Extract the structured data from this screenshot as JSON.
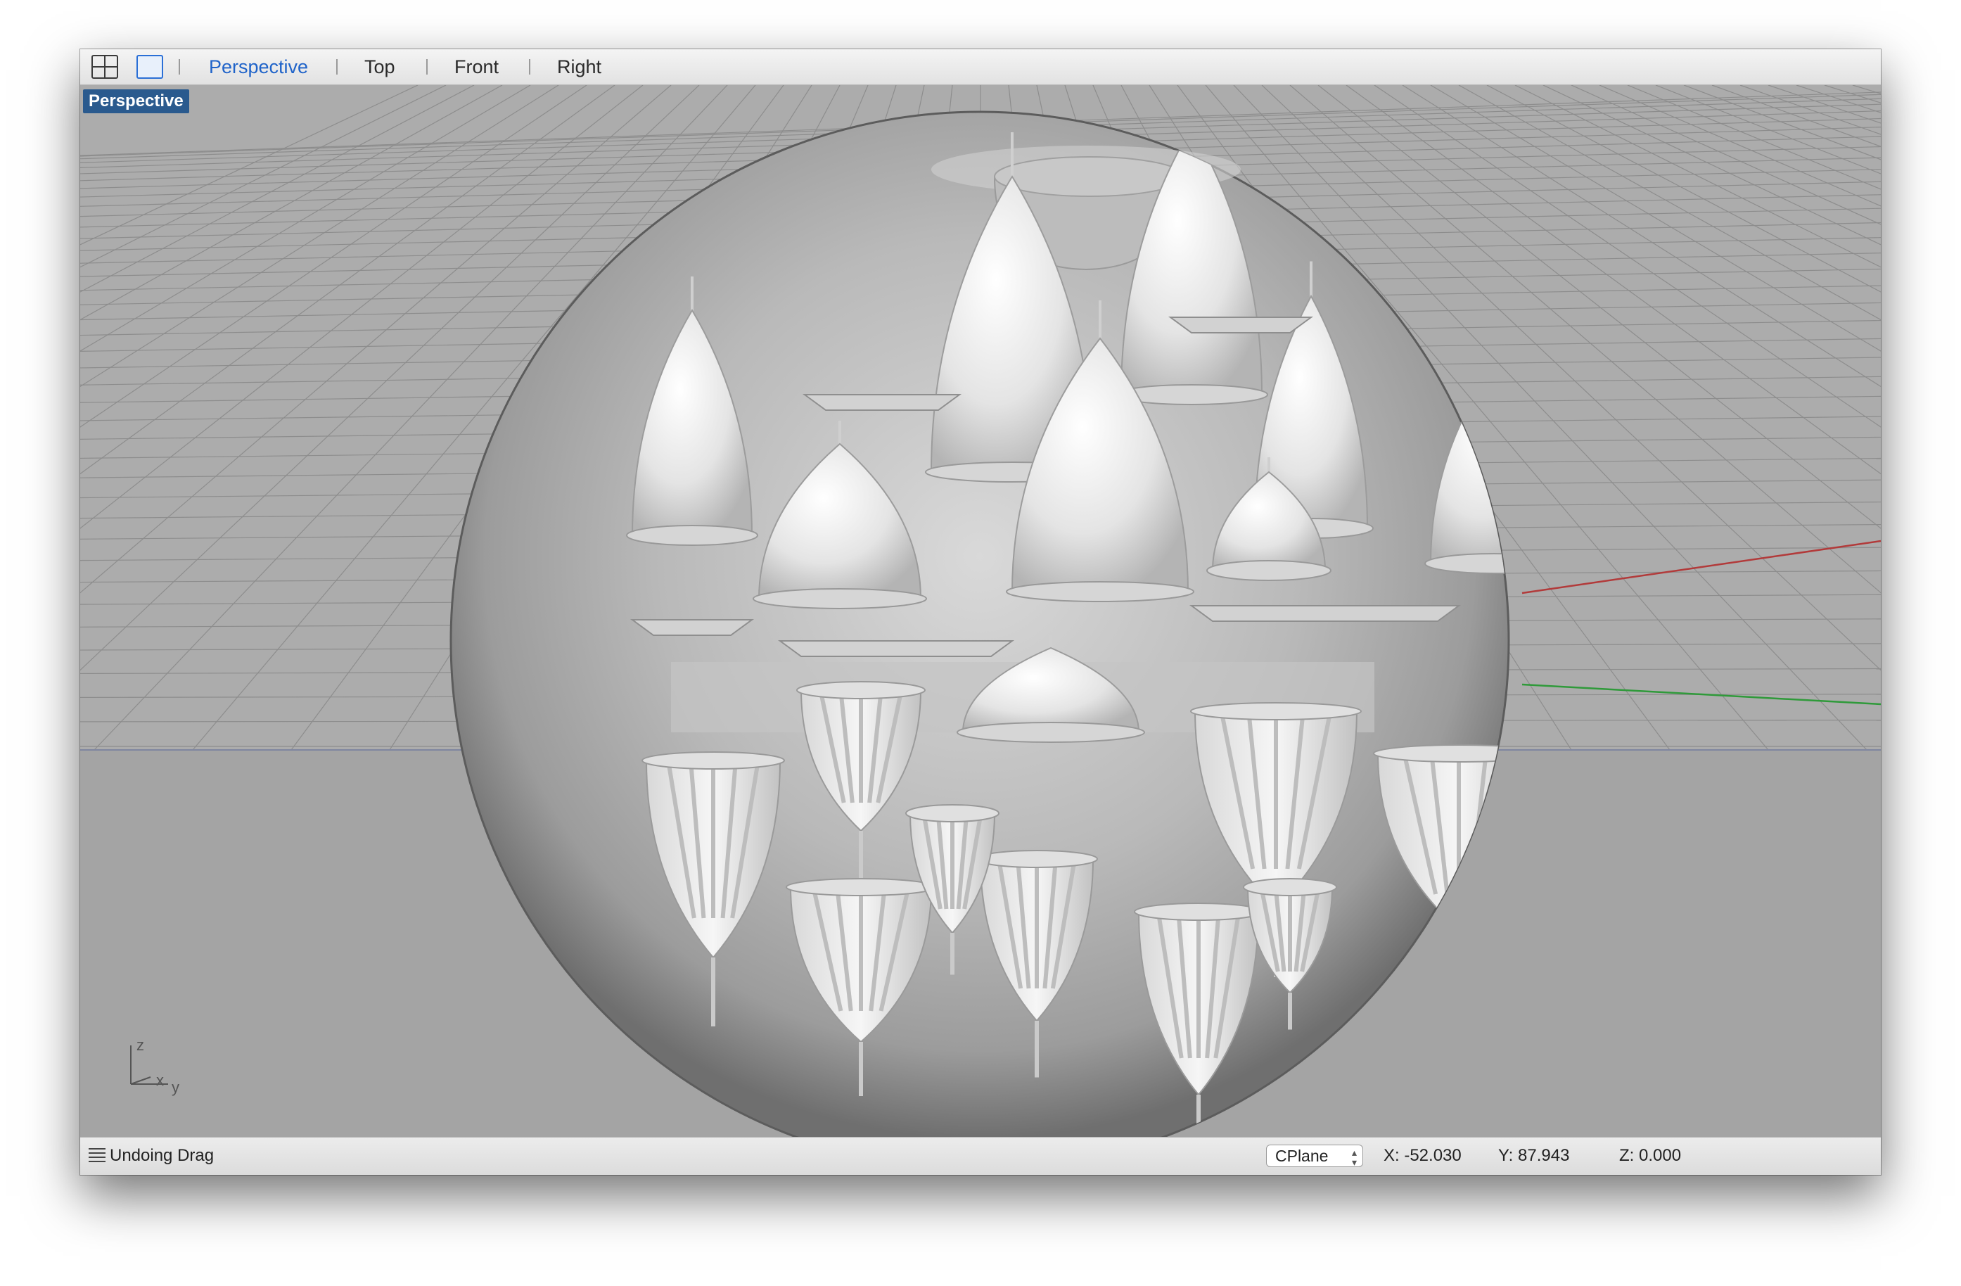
{
  "toolbar": {
    "tabs": [
      {
        "label": "Perspective",
        "active": true
      },
      {
        "label": "Top",
        "active": false
      },
      {
        "label": "Front",
        "active": false
      },
      {
        "label": "Right",
        "active": false
      }
    ]
  },
  "viewport": {
    "label": "Perspective",
    "axis_labels": {
      "z": "z",
      "x": "x",
      "y": "y"
    }
  },
  "status": {
    "message": "Undoing Drag",
    "cplane": "CPlane",
    "x": "X: -52.030",
    "y": "Y: 87.943",
    "z": "Z: 0.000"
  },
  "colors": {
    "accent": "#1f63c9",
    "viewport_label_bg": "#2a5a8e",
    "viewport_bg": "#a9a9a9",
    "x_axis": "#b23a3a",
    "y_axis": "#2f9a3a"
  }
}
